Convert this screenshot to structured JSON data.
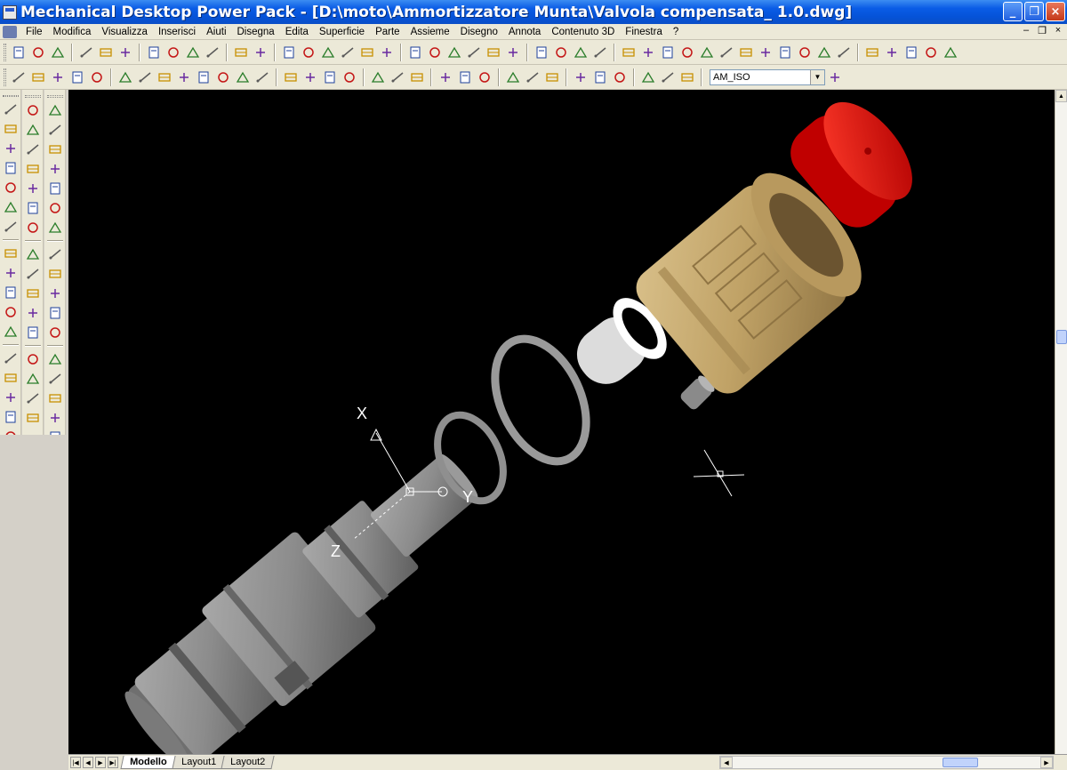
{
  "window": {
    "title": "Mechanical Desktop Power Pack - [D:\\moto\\Ammortizzatore Munta\\Valvola compensata_ 1.0.dwg]",
    "minimize_glyph": "_",
    "maximize_glyph": "❐",
    "close_glyph": "×"
  },
  "menu": {
    "items": [
      "File",
      "Modifica",
      "Visualizza",
      "Inserisci",
      "Aiuti",
      "Disegna",
      "Edita",
      "Superficie",
      "Parte",
      "Assieme",
      "Disegno",
      "Annota",
      "Contenuto 3D",
      "Finestra",
      "?"
    ],
    "mdi_min": "–",
    "mdi_restore": "❐",
    "mdi_close": "×"
  },
  "toolbar2": {
    "dimstyle_value": "AM_ISO"
  },
  "layout_tabs": [
    "Modello",
    "Layout1",
    "Layout2"
  ],
  "active_tab": "Modello",
  "ucs": {
    "x_label": "X",
    "y_label": "Y",
    "z_label": "Z"
  },
  "colors": {
    "viewport_bg": "#000000",
    "cap_red": "#e01010",
    "knob_tan": "#c2a66e",
    "metal_gray": "#8a8a8a",
    "ring_white": "#eeeeee"
  },
  "icons": {
    "toolbar1": [
      "new-icon",
      "open-icon",
      "save-icon",
      "print-icon",
      "print-preview-icon",
      "find-icon",
      "cut-icon",
      "copy-icon",
      "paste-icon",
      "match-properties-icon",
      "undo-icon",
      "redo-icon",
      "toolpalette-icon",
      "web-icon",
      "globe-icon",
      "layers-icon",
      "pan-icon",
      "magnet-icon",
      "ucs-icon",
      "view-icon",
      "orbit-icon",
      "zoom-realtime-icon",
      "zoom-window-icon",
      "zoom-previous-icon",
      "properties-icon",
      "designcenter-icon",
      "help-icon",
      "sparkle-icon",
      "part-icon",
      "feature-icon",
      "sketch-icon",
      "profile-icon",
      "constraint-icon",
      "dimension-icon",
      "extrude-icon",
      "revolve-icon",
      "sweep-icon",
      "loft-icon",
      "hole-icon",
      "fillet-icon",
      "layer-bar-icon",
      "layer-red-icon",
      "layer-redhat-icon",
      "layer-state-icon",
      "layer-tools-icon"
    ],
    "toolbar2": [
      "table-icon",
      "bom-icon",
      "balloon-icon",
      "callout-icon",
      "view-create-icon",
      "section-a-icon",
      "section-b-icon",
      "section-c-icon",
      "section-d-icon",
      "section-e-icon",
      "section-f-icon",
      "section-g-icon",
      "section-h-icon",
      "spring-icon",
      "shaft-icon",
      "gear-icon",
      "lines-icon",
      "linear-dim-icon",
      "aligned-dim-icon",
      "ordinate-dim-icon",
      "radius-dim-icon",
      "diameter-dim-icon",
      "angle-dim-icon",
      "baseline-dim-icon",
      "continue-dim-icon",
      "chain-dim-icon",
      "leader-icon",
      "tolerance-icon",
      "center-mark-icon",
      "text-a-icon",
      "text-b-icon",
      "datum-icon",
      "dimstyle-icon"
    ],
    "left1": [
      "line-icon",
      "ray-icon",
      "xline-icon",
      "multiline-icon",
      "polyline-icon",
      "polygon-icon",
      "rectangle-icon",
      "arc-icon",
      "circle-icon",
      "spline-icon",
      "ellipse-icon",
      "ellipse-arc-icon",
      "insert-block-icon",
      "make-block-icon",
      "point-icon",
      "hatch-icon",
      "region-icon",
      "mtext-icon"
    ],
    "left2": [
      "erase-icon",
      "copy-object-icon",
      "mirror-icon",
      "offset-icon",
      "array-icon",
      "move-icon",
      "rotate-icon",
      "scale-icon",
      "stretch-icon",
      "lengthen-icon",
      "trim-icon",
      "extend-icon",
      "break-icon",
      "chamfer-icon",
      "fillet-edit-icon",
      "explode-icon"
    ],
    "left3": [
      "dim-line-icon",
      "dim-corner-icon",
      "dim-slash-icon",
      "dim-angle-icon",
      "dim-cross-icon",
      "dim-cross2-icon",
      "dim-dash-icon",
      "circle-center-icon",
      "circle-target-icon",
      "circle-tangent-icon",
      "perpendicular-icon",
      "parallel-icon",
      "snap-insert-icon",
      "node-icon",
      "nearest-icon",
      "none-snap-icon",
      "osnap-settings-icon"
    ]
  }
}
